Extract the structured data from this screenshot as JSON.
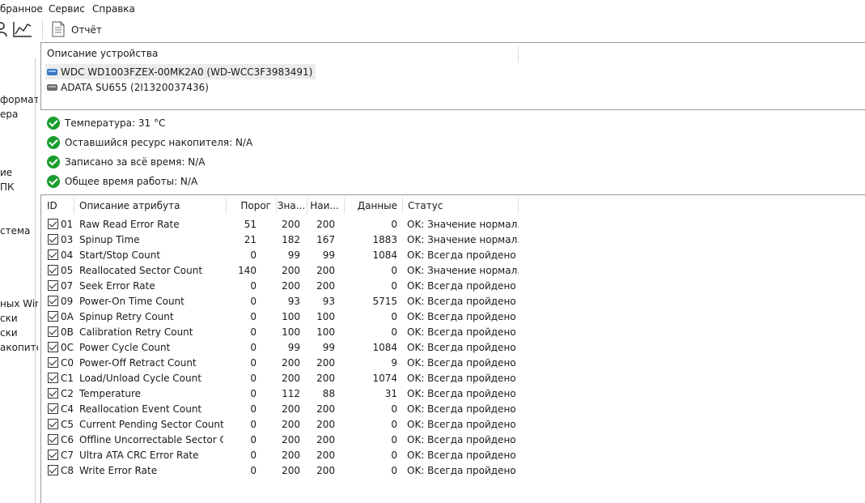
{
  "menu": {
    "items": [
      "бранное",
      "Сервис",
      "Справка"
    ]
  },
  "toolbar": {
    "report_label": "Отчёт"
  },
  "left_panel": {
    "items": [
      "формат",
      "ера",
      "ие",
      "ПК",
      "стема",
      "ных Win",
      "ски",
      "ски",
      "акопите"
    ]
  },
  "device_section": {
    "header": "Описание устройства",
    "devices": [
      {
        "label": "WDC WD1003FZEX-00MK2A0 (WD-WCC3F3983491)",
        "selected": true
      },
      {
        "label": "ADATA SU655 (2I1320037436)",
        "selected": false
      }
    ]
  },
  "status": {
    "items": [
      "Температура: 31 °C",
      "Оставшийся ресурс накопителя: N/A",
      "Записано за всё время: N/A",
      "Общее время работы: N/A"
    ]
  },
  "attributes": {
    "columns": {
      "id": "ID",
      "description": "Описание атрибута",
      "threshold": "Порог",
      "value": "Зна...",
      "worst": "Наи...",
      "data": "Данные",
      "status": "Статус"
    },
    "rows": [
      {
        "id": "01",
        "name": "Raw Read Error Rate",
        "threshold": "51",
        "value": "200",
        "worst": "200",
        "data": "0",
        "status": "OK: Значение нормал..."
      },
      {
        "id": "03",
        "name": "Spinup Time",
        "threshold": "21",
        "value": "182",
        "worst": "167",
        "data": "1883",
        "status": "OK: Значение нормал..."
      },
      {
        "id": "04",
        "name": "Start/Stop Count",
        "threshold": "0",
        "value": "99",
        "worst": "99",
        "data": "1084",
        "status": "OK: Всегда пройдено"
      },
      {
        "id": "05",
        "name": "Reallocated Sector Count",
        "threshold": "140",
        "value": "200",
        "worst": "200",
        "data": "0",
        "status": "OK: Значение нормал..."
      },
      {
        "id": "07",
        "name": "Seek Error Rate",
        "threshold": "0",
        "value": "200",
        "worst": "200",
        "data": "0",
        "status": "OK: Всегда пройдено"
      },
      {
        "id": "09",
        "name": "Power-On Time Count",
        "threshold": "0",
        "value": "93",
        "worst": "93",
        "data": "5715",
        "status": "OK: Всегда пройдено"
      },
      {
        "id": "0A",
        "name": "Spinup Retry Count",
        "threshold": "0",
        "value": "100",
        "worst": "100",
        "data": "0",
        "status": "OK: Всегда пройдено"
      },
      {
        "id": "0B",
        "name": "Calibration Retry Count",
        "threshold": "0",
        "value": "100",
        "worst": "100",
        "data": "0",
        "status": "OK: Всегда пройдено"
      },
      {
        "id": "0C",
        "name": "Power Cycle Count",
        "threshold": "0",
        "value": "99",
        "worst": "99",
        "data": "1084",
        "status": "OK: Всегда пройдено"
      },
      {
        "id": "C0",
        "name": "Power-Off Retract Count",
        "threshold": "0",
        "value": "200",
        "worst": "200",
        "data": "9",
        "status": "OK: Всегда пройдено"
      },
      {
        "id": "C1",
        "name": "Load/Unload Cycle Count",
        "threshold": "0",
        "value": "200",
        "worst": "200",
        "data": "1074",
        "status": "OK: Всегда пройдено"
      },
      {
        "id": "C2",
        "name": "Temperature",
        "threshold": "0",
        "value": "112",
        "worst": "88",
        "data": "31",
        "status": "OK: Всегда пройдено"
      },
      {
        "id": "C4",
        "name": "Reallocation Event Count",
        "threshold": "0",
        "value": "200",
        "worst": "200",
        "data": "0",
        "status": "OK: Всегда пройдено"
      },
      {
        "id": "C5",
        "name": "Current Pending Sector Count",
        "threshold": "0",
        "value": "200",
        "worst": "200",
        "data": "0",
        "status": "OK: Всегда пройдено"
      },
      {
        "id": "C6",
        "name": "Offline Uncorrectable Sector C...",
        "threshold": "0",
        "value": "200",
        "worst": "200",
        "data": "0",
        "status": "OK: Всегда пройдено"
      },
      {
        "id": "C7",
        "name": "Ultra ATA CRC Error Rate",
        "threshold": "0",
        "value": "200",
        "worst": "200",
        "data": "0",
        "status": "OK: Всегда пройдено"
      },
      {
        "id": "C8",
        "name": "Write Error Rate",
        "threshold": "0",
        "value": "200",
        "worst": "200",
        "data": "0",
        "status": "OK: Всегда пройдено"
      }
    ]
  }
}
